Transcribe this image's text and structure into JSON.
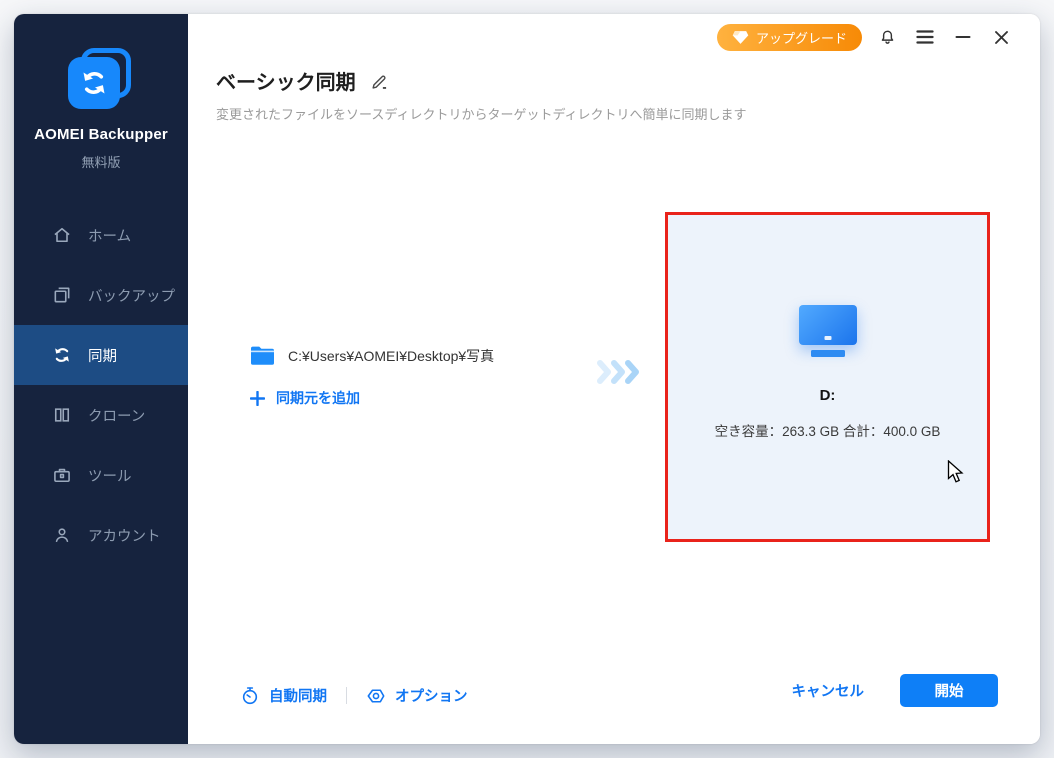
{
  "app": {
    "name": "AOMEI Backupper",
    "edition": "無料版"
  },
  "titlebar": {
    "upgrade_label": "アップグレード"
  },
  "sidebar": {
    "items": [
      {
        "label": "ホーム",
        "icon": "home-icon",
        "selected": false
      },
      {
        "label": "バックアップ",
        "icon": "backup-icon",
        "selected": false
      },
      {
        "label": "同期",
        "icon": "sync-icon",
        "selected": true
      },
      {
        "label": "クローン",
        "icon": "clone-icon",
        "selected": false
      },
      {
        "label": "ツール",
        "icon": "tools-icon",
        "selected": false
      },
      {
        "label": "アカウント",
        "icon": "account-icon",
        "selected": false
      }
    ]
  },
  "header": {
    "title": "ベーシック同期",
    "subtitle": "変更されたファイルをソースディレクトリからターゲットディレクトリへ簡単に同期します"
  },
  "sync": {
    "source": {
      "path": "C:¥Users¥AOMEI¥Desktop¥写真"
    },
    "add_source_label": "同期元を追加",
    "target": {
      "drive_label": "D:",
      "capacity_text": "空き容量：263.3 GB 合計：400.0 GB",
      "highlighted": true
    }
  },
  "footer": {
    "auto_sync_label": "自動同期",
    "options_label": "オプション",
    "cancel_label": "キャンセル",
    "start_label": "開始"
  },
  "colors": {
    "sidebar_bg": "#16233E",
    "sidebar_selected_bg": "#1D4C84",
    "logo_blue": "#1788FB",
    "accent_link_blue": "#1176F3",
    "start_button_bg": "#0E7FF7",
    "upgrade_gradient_start": "#FFB23F",
    "upgrade_gradient_end": "#F78A06",
    "target_highlight_border": "#E9231B",
    "target_box_bg": "#EDF3FB"
  }
}
